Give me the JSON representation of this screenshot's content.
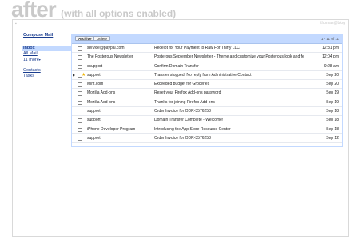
{
  "banner": {
    "title": "after",
    "subtitle": "(with all options enabled)"
  },
  "account": {
    "label": "thomas@blog"
  },
  "sidebar": {
    "compose": "Compose Mail",
    "nav": [
      {
        "label": "Inbox",
        "selected": true
      },
      {
        "label": "All Mail",
        "selected": false
      },
      {
        "label": "11 more",
        "selected": false
      }
    ],
    "nav2": [
      {
        "label": "Contacts"
      },
      {
        "label": "Tasks"
      }
    ]
  },
  "toolbar": {
    "archive": "Archive",
    "delete": "Delete",
    "pager": "1 - 11 of 11"
  },
  "messages": [
    {
      "sender": "service@paypal.com",
      "subject": "Receipt for Your Payment to Raw For Thirty LLC",
      "date": "12:31 pm",
      "starred": false,
      "indicator": false
    },
    {
      "sender": "The Posterous Newsletter",
      "subject": "Posterous September Newsletter - Theme and customize your Posterous look and fe",
      "date": "12:04 pm",
      "starred": false,
      "indicator": false
    },
    {
      "sender": "csupport",
      "subject": "Confirm Domain Transfer",
      "date": "9:28 am",
      "starred": false,
      "indicator": false
    },
    {
      "sender": "support",
      "subject": "Transfer stopped: No reply from Administrative Contact",
      "date": "Sep 20",
      "starred": true,
      "indicator": true
    },
    {
      "sender": "Mint.com",
      "subject": "Exceeded budget for Groceries",
      "date": "Sep 20",
      "starred": false,
      "indicator": false
    },
    {
      "sender": "Mozilla Add-ons",
      "subject": "Reset your Firefox Add-ons password",
      "date": "Sep 19",
      "starred": false,
      "indicator": false
    },
    {
      "sender": "Mozilla Add-ons",
      "subject": "Thanks for joining Firefox Add-ons",
      "date": "Sep 19",
      "starred": false,
      "indicator": false
    },
    {
      "sender": "support",
      "subject": "Order Invoice for ODR-3576258",
      "date": "Sep 18",
      "starred": false,
      "indicator": false
    },
    {
      "sender": "support",
      "subject": "Domain Transfer Complete - Welcome!",
      "date": "Sep 18",
      "starred": false,
      "indicator": false
    },
    {
      "sender": "iPhone Developer Program",
      "subject": "Introducing the App Store Resource Center",
      "date": "Sep 18",
      "starred": false,
      "indicator": false
    },
    {
      "sender": "support",
      "subject": "Order Invoice for ODR-3576258",
      "date": "Sep 12",
      "starred": false,
      "indicator": false
    }
  ]
}
